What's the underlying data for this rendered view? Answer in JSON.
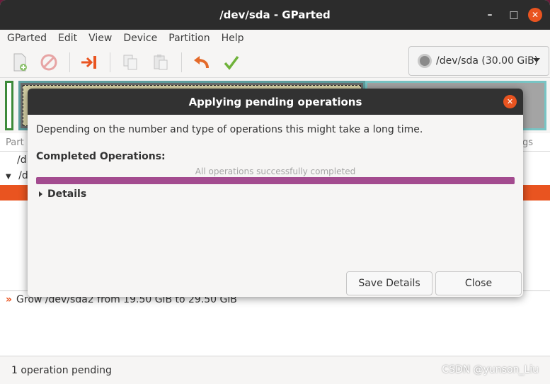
{
  "window": {
    "title": "/dev/sda - GParted"
  },
  "menubar": {
    "items": [
      "GParted",
      "Edit",
      "View",
      "Device",
      "Partition",
      "Help"
    ]
  },
  "toolbar": {
    "buttons": [
      {
        "icon": "new-partition-icon"
      },
      {
        "icon": "delete-icon"
      },
      {
        "icon": "resize-move-icon"
      },
      {
        "icon": "copy-icon"
      },
      {
        "icon": "paste-icon"
      },
      {
        "icon": "undo-icon"
      },
      {
        "icon": "apply-icon"
      }
    ]
  },
  "device_selector": {
    "value": "/dev/sda (30.00 GiB)"
  },
  "partition_list": {
    "header_left": "Part",
    "header_right": "gs",
    "rows": [
      "/d",
      "/d"
    ]
  },
  "pending_ops": {
    "items": [
      "Grow /dev/sda2 from 19.50 GiB to 29.50 GiB"
    ]
  },
  "statusbar": {
    "text": "1 operation pending"
  },
  "watermark": {
    "text": "CSDN @yunson_Liu"
  },
  "dialog": {
    "title": "Applying pending operations",
    "description": "Depending on the number and type of operations this might take a long time.",
    "completed_label": "Completed Operations:",
    "status_text": "All operations successfully completed",
    "progress": 1.0,
    "details_label": "Details",
    "save_button": "Save Details",
    "close_button": "Close"
  },
  "colors": {
    "accent": "#e95420",
    "progress": "#a34b8f",
    "titlebar": "#2c2c2c"
  }
}
